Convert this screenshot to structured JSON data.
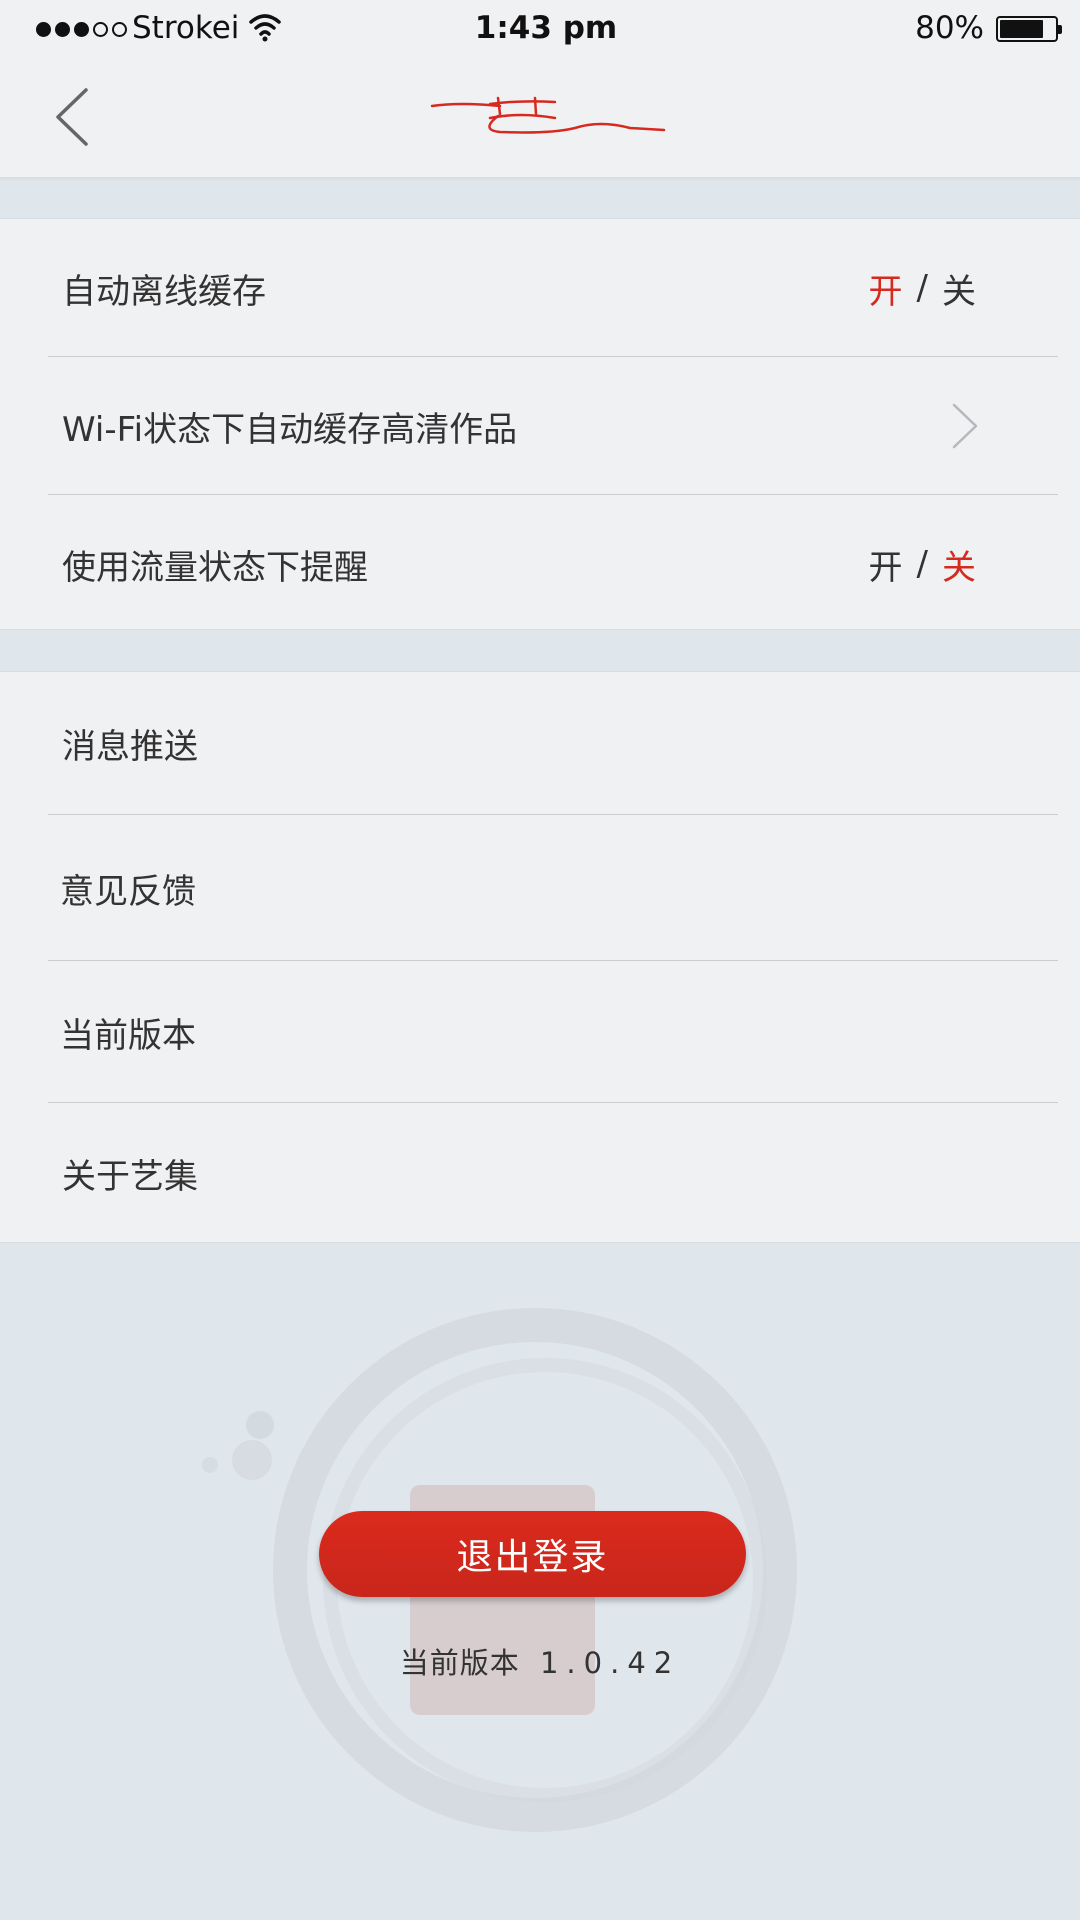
{
  "status_bar": {
    "carrier": "Strokei",
    "time": "1:43 pm",
    "battery_percent": "80%",
    "battery_level": 0.8,
    "signal_bars_filled": 3,
    "signal_bars_total": 5
  },
  "nav": {
    "back_icon": "chevron-left-icon",
    "logo_icon": "brush-calligraphy-logo",
    "logo_color": "#d6291f"
  },
  "settings_group1": {
    "items": [
      {
        "label": "自动离线缓存",
        "toggle_on": "开",
        "toggle_sep": "/",
        "toggle_off": "关",
        "selected": "on"
      },
      {
        "label": "Wi-Fi状态下自动缓存高清作品",
        "icon": "chevron-right-icon"
      },
      {
        "label": "使用流量状态下提醒",
        "toggle_on": "开",
        "toggle_sep": "/",
        "toggle_off": "关",
        "selected": "off"
      }
    ]
  },
  "settings_group2": {
    "items": [
      {
        "label": "消息推送"
      },
      {
        "label": "意见反馈"
      },
      {
        "label": "当前版本"
      },
      {
        "label": "关于艺集"
      }
    ]
  },
  "footer": {
    "logout_label": "退出登录",
    "version_label": "当前版本",
    "version_number": "1.0.42"
  },
  "colors": {
    "accent": "#d6291f",
    "background": "#dfe6ec",
    "panel": "#f0f1f3"
  }
}
